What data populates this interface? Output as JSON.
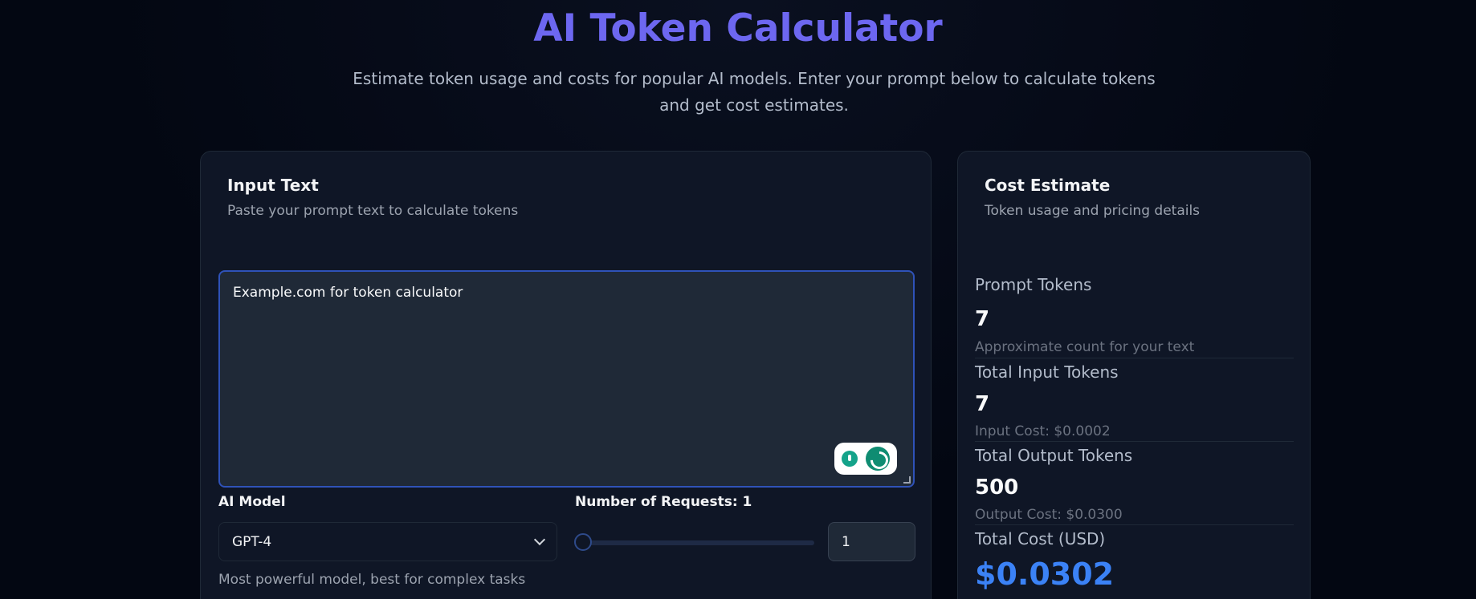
{
  "header": {
    "title": "AI Token Calculator",
    "subtitle": "Estimate token usage and costs for popular AI models. Enter your prompt below to calculate tokens and get cost estimates."
  },
  "input_card": {
    "title": "Input Text",
    "description": "Paste your prompt text to calculate tokens",
    "textarea_value": "Example.com for token calculator",
    "model_label": "AI Model",
    "model_selected": "GPT-4",
    "model_description": "Most powerful model, best for complex tasks",
    "requests_label": "Number of Requests: 1",
    "requests_value": "1",
    "requests_slider_fraction": 0
  },
  "cost_card": {
    "title": "Cost Estimate",
    "description": "Token usage and pricing details",
    "prompt_tokens_label": "Prompt Tokens",
    "prompt_tokens_value": "7",
    "prompt_tokens_note": "Approximate count for your text",
    "total_input_label": "Total Input Tokens",
    "total_input_value": "7",
    "input_cost_note": "Input Cost: $0.0002",
    "total_output_label": "Total Output Tokens",
    "total_output_value": "500",
    "output_cost_note": "Output Cost: $0.0300",
    "total_cost_label": "Total Cost (USD)",
    "total_cost_value": "$0.0302"
  },
  "colors": {
    "title_accent": "#6d67f0",
    "total_cost": "#3b82f6",
    "background": "#030712"
  },
  "icons": [
    "chevron-down-icon",
    "bulb-icon",
    "grammarly-logo-icon"
  ]
}
